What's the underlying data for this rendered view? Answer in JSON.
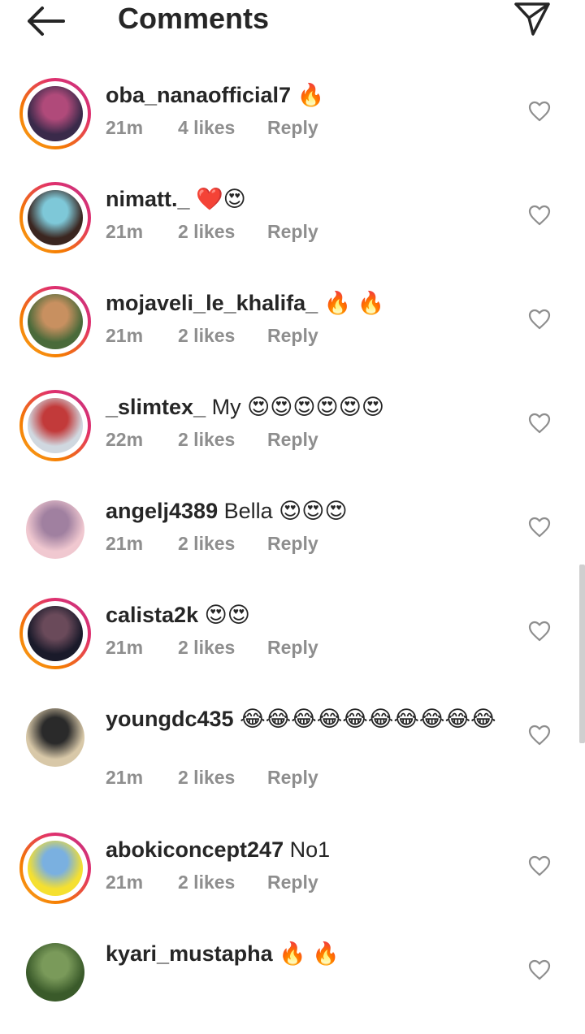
{
  "header": {
    "title": "Comments",
    "back_icon": "arrow-left-icon",
    "share_icon": "paper-plane-icon"
  },
  "comments": [
    {
      "username": "oba_nanaofficial7",
      "text": "🔥",
      "time": "21m",
      "likes": "4 likes",
      "reply": "Reply",
      "ring": true,
      "avatar_colors": [
        "#3a2a4a",
        "#b04a7a"
      ]
    },
    {
      "username": "nimatt._",
      "text": "❤️😍",
      "time": "21m",
      "likes": "2 likes",
      "reply": "Reply",
      "ring": true,
      "avatar_colors": [
        "#3b2620",
        "#7ec8d8"
      ]
    },
    {
      "username": "mojaveli_le_khalifa_",
      "text": "🔥 🔥",
      "time": "21m",
      "likes": "2 likes",
      "reply": "Reply",
      "ring": true,
      "avatar_colors": [
        "#4a6a3a",
        "#c89060"
      ]
    },
    {
      "username": "_slimtex_",
      "text": "My 😍😍😍😍😍😍",
      "time": "22m",
      "likes": "2 likes",
      "reply": "Reply",
      "ring": true,
      "avatar_colors": [
        "#d0d8e0",
        "#c23a3a"
      ]
    },
    {
      "username": "angelj4389",
      "text": "Bella 😍😍😍",
      "time": "21m",
      "likes": "2 likes",
      "reply": "Reply",
      "ring": false,
      "avatar_colors": [
        "#f0c8d0",
        "#a080a0"
      ]
    },
    {
      "username": "calista2k",
      "text": "😍😍",
      "time": "21m",
      "likes": "2 likes",
      "reply": "Reply",
      "ring": true,
      "avatar_colors": [
        "#1a1a2a",
        "#6a4a5a"
      ]
    },
    {
      "username": "youngdc435",
      "text": "😂😂😂😂😂😂😂😂😂😂",
      "time": "21m",
      "likes": "2 likes",
      "reply": "Reply",
      "ring": false,
      "avatar_colors": [
        "#d8c8a8",
        "#2a2a2a"
      ]
    },
    {
      "username": "abokiconcept247",
      "text": "No1",
      "time": "21m",
      "likes": "2 likes",
      "reply": "Reply",
      "ring": true,
      "avatar_colors": [
        "#f5e030",
        "#7ab0e0"
      ]
    },
    {
      "username": "kyari_mustapha",
      "text": "🔥 🔥",
      "time": "",
      "likes": "",
      "reply": "",
      "ring": false,
      "avatar_colors": [
        "#3a5a2a",
        "#7a9a5a"
      ]
    }
  ],
  "colors": {
    "text": "#262626",
    "meta": "#8e8e8e",
    "ring_start": "#f9a825",
    "ring_end": "#c13584"
  }
}
